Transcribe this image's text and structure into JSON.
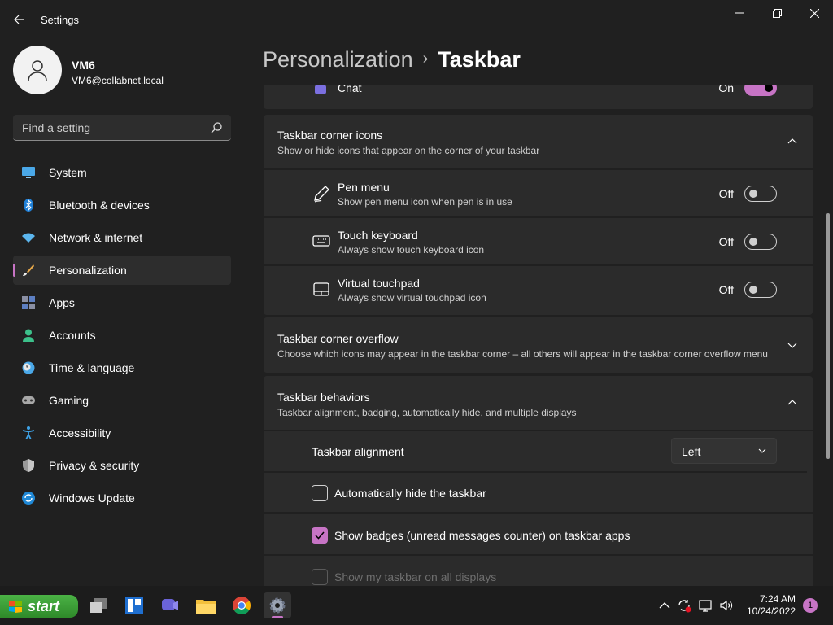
{
  "window": {
    "title": "Settings",
    "minimize_icon": "minimize-icon",
    "maximize_icon": "restore-icon",
    "close_icon": "close-icon"
  },
  "profile": {
    "name": "VM6",
    "email": "VM6@collabnet.local"
  },
  "search": {
    "placeholder": "Find a setting"
  },
  "nav": {
    "items": [
      {
        "label": "System",
        "icon": "monitor-icon",
        "active": false
      },
      {
        "label": "Bluetooth & devices",
        "icon": "bluetooth-icon",
        "active": false
      },
      {
        "label": "Network & internet",
        "icon": "wifi-icon",
        "active": false
      },
      {
        "label": "Personalization",
        "icon": "brush-icon",
        "active": true
      },
      {
        "label": "Apps",
        "icon": "apps-icon",
        "active": false
      },
      {
        "label": "Accounts",
        "icon": "person-icon",
        "active": false
      },
      {
        "label": "Time & language",
        "icon": "clock-globe-icon",
        "active": false
      },
      {
        "label": "Gaming",
        "icon": "gamepad-icon",
        "active": false
      },
      {
        "label": "Accessibility",
        "icon": "accessibility-icon",
        "active": false
      },
      {
        "label": "Privacy & security",
        "icon": "shield-icon",
        "active": false
      },
      {
        "label": "Windows Update",
        "icon": "update-icon",
        "active": false
      }
    ]
  },
  "breadcrumb": {
    "parent": "Personalization",
    "separator": "›",
    "current": "Taskbar"
  },
  "chat_row": {
    "label": "Chat",
    "state": "On"
  },
  "corner_icons": {
    "title": "Taskbar corner icons",
    "description": "Show or hide icons that appear on the corner of your taskbar",
    "items": [
      {
        "title": "Pen menu",
        "desc": "Show pen menu icon when pen is in use",
        "state": "Off",
        "icon": "pen-icon"
      },
      {
        "title": "Touch keyboard",
        "desc": "Always show touch keyboard icon",
        "state": "Off",
        "icon": "keyboard-icon"
      },
      {
        "title": "Virtual touchpad",
        "desc": "Always show virtual touchpad icon",
        "state": "Off",
        "icon": "touchpad-icon"
      }
    ]
  },
  "corner_overflow": {
    "title": "Taskbar corner overflow",
    "description": "Choose which icons may appear in the taskbar corner – all others will appear in the taskbar corner overflow menu"
  },
  "behaviors": {
    "title": "Taskbar behaviors",
    "description": "Taskbar alignment, badging, automatically hide, and multiple displays",
    "alignment_label": "Taskbar alignment",
    "alignment_value": "Left",
    "auto_hide_label": "Automatically hide the taskbar",
    "auto_hide_checked": false,
    "badges_label": "Show badges (unread messages counter) on taskbar apps",
    "badges_checked": true,
    "all_displays_label": "Show my taskbar on all displays",
    "all_displays_enabled": false
  },
  "taskbar": {
    "start_label": "start",
    "apps": [
      "task-view-icon",
      "widgets-icon",
      "chat-icon",
      "file-explorer-icon",
      "chrome-icon",
      "settings-icon"
    ],
    "time": "7:24 AM",
    "date": "10/24/2022",
    "notification_count": "1"
  },
  "colors": {
    "accent": "#c774c5",
    "background": "#202020",
    "card": "#2b2b2b"
  }
}
